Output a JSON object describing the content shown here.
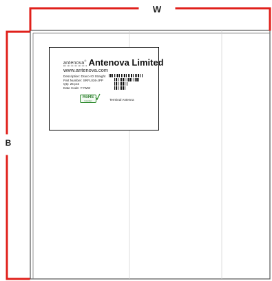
{
  "dimensions": {
    "width_marker": "W",
    "height_marker": "B"
  },
  "label": {
    "logo_text": "antenova",
    "company": "Antenova Limited",
    "website": "www.antenova.com",
    "lines": [
      "Description: Draco-IO Straight",
      "Part Number: SRFL036-JPP",
      "Qty: 25 pcs",
      "Date Code: YYWW"
    ],
    "rohs": "RoHS",
    "rohs_sub": "Compliant",
    "footer": "Terminal Antenna"
  },
  "colors": {
    "marker_red": "#e0201b",
    "tray_border": "#555555",
    "divider": "#cccccc",
    "rohs_green": "#2e8b2e"
  }
}
